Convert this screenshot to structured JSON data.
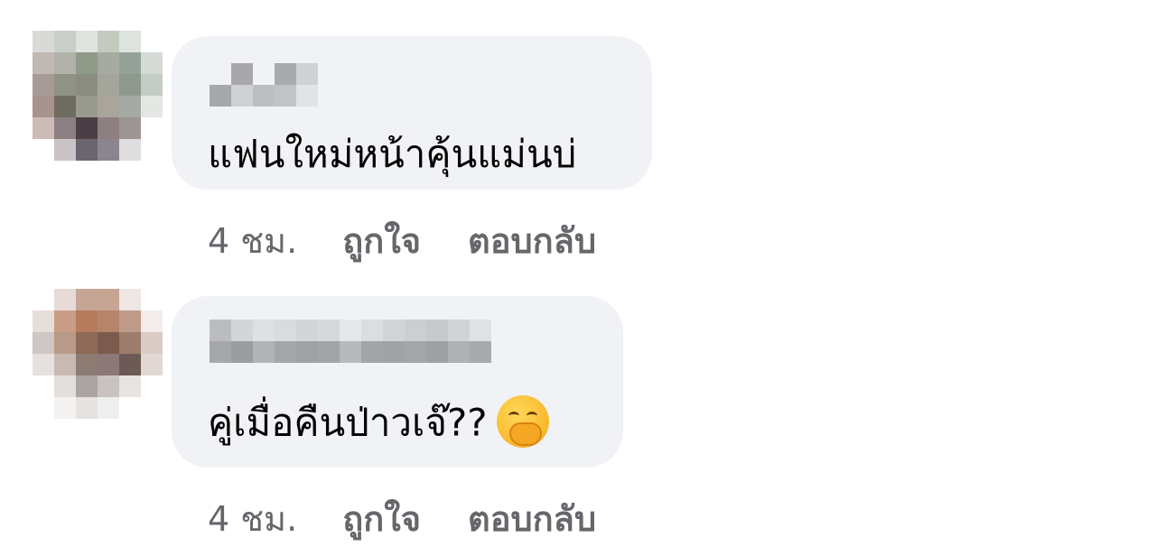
{
  "comments": [
    {
      "author": "",
      "text": "แฟนใหม่หน้าคุ้นแม่นบ่",
      "time": "4 ชม.",
      "like_label": "ถูกใจ",
      "reply_label": "ตอบกลับ",
      "emoji": ""
    },
    {
      "author": "",
      "text": "คู่เมื่อคืนป่าวเจ๊??",
      "time": "4 ชม.",
      "like_label": "ถูกใจ",
      "reply_label": "ตอบกลับ",
      "emoji": "hand-over-mouth-emoji"
    }
  ],
  "colors": {
    "bubble": "#f0f2f5",
    "meta_text": "#65676b",
    "comment_text": "#050505"
  }
}
